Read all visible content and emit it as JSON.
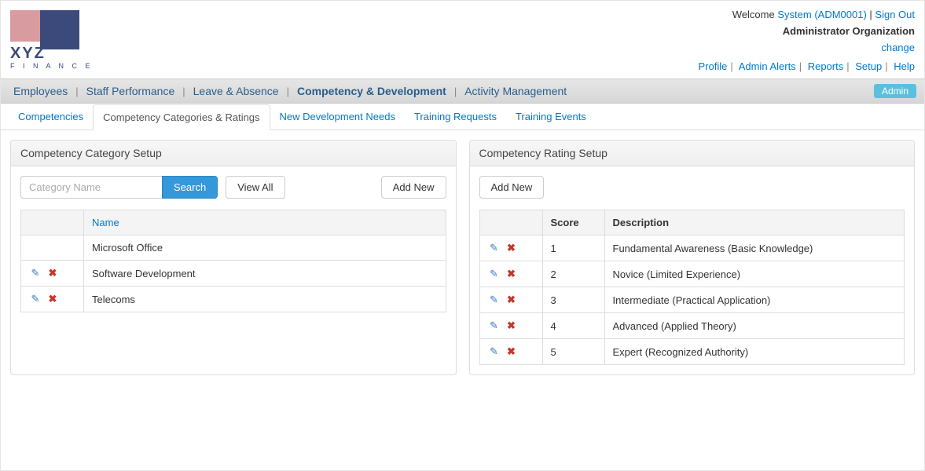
{
  "header": {
    "welcome": "Welcome",
    "user_link": "System (ADM0001)",
    "signout": "Sign Out",
    "org": "Administrator Organization",
    "change": "change",
    "links": [
      "Profile",
      "Admin Alerts",
      "Reports",
      "Setup",
      "Help"
    ]
  },
  "logo": {
    "main": "XYZ",
    "sub": "F I N A N C E"
  },
  "main_nav": {
    "items": [
      "Employees",
      "Staff Performance",
      "Leave & Absence",
      "Competency & Development",
      "Activity Management"
    ],
    "active_index": 3,
    "badge": "Admin"
  },
  "sub_nav": {
    "items": [
      "Competencies",
      "Competency Categories & Ratings",
      "New Development Needs",
      "Training Requests",
      "Training Events"
    ],
    "active_index": 1
  },
  "left_panel": {
    "title": "Competency Category Setup",
    "search_placeholder": "Category Name",
    "search_btn": "Search",
    "viewall_btn": "View All",
    "addnew_btn": "Add New",
    "col_name": "Name",
    "rows": [
      {
        "name": "Microsoft Office",
        "actions": false
      },
      {
        "name": "Software Development",
        "actions": true
      },
      {
        "name": "Telecoms",
        "actions": true
      }
    ]
  },
  "right_panel": {
    "title": "Competency Rating Setup",
    "addnew_btn": "Add New",
    "col_score": "Score",
    "col_desc": "Description",
    "rows": [
      {
        "score": "1",
        "desc": "Fundamental Awareness (Basic Knowledge)"
      },
      {
        "score": "2",
        "desc": "Novice (Limited Experience)"
      },
      {
        "score": "3",
        "desc": "Intermediate (Practical Application)"
      },
      {
        "score": "4",
        "desc": "Advanced (Applied Theory)"
      },
      {
        "score": "5",
        "desc": "Expert (Recognized Authority)"
      }
    ]
  }
}
